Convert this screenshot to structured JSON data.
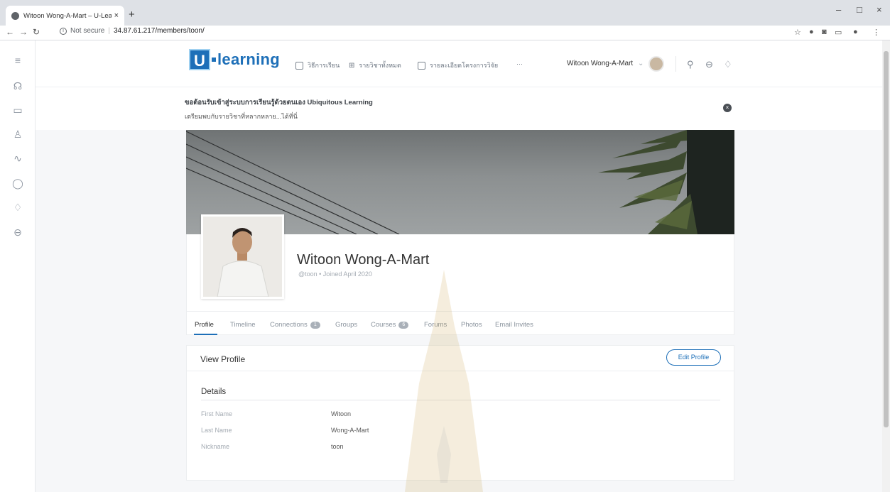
{
  "browser": {
    "tab_title": "Witoon Wong-A-Mart – U-Learn",
    "tab_close": "×",
    "new_tab": "+",
    "url_security": "Not secure",
    "url": "34.87.61.217/members/toon/",
    "window_controls": [
      "–",
      "□",
      "×"
    ]
  },
  "header": {
    "logo_text": "learning",
    "logo_letter": "U",
    "menu": [
      "วิธีการเรียน",
      "รายวิชาทั้งหมด",
      "รายละเอียดโครงการวิจัย",
      "···"
    ],
    "user_name": "Witoon Wong-A-Mart"
  },
  "welcome": {
    "title": "ขอต้อนรับเข้าสู่ระบบการเรียนรู้ด้วยตนเอง Ubiquitous Learning",
    "subtitle": "เตรียมพบกับรายวิชาที่หลากหลาย...ได้ที่นี่",
    "close": "×"
  },
  "profile": {
    "name": "Witoon Wong-A-Mart",
    "meta": "@toon • Joined April 2020",
    "tabs": [
      {
        "label": "Profile",
        "badge": ""
      },
      {
        "label": "Timeline",
        "badge": ""
      },
      {
        "label": "Connections",
        "badge": "1"
      },
      {
        "label": "Groups",
        "badge": ""
      },
      {
        "label": "Courses",
        "badge": "6"
      },
      {
        "label": "Forums",
        "badge": ""
      },
      {
        "label": "Photos",
        "badge": ""
      },
      {
        "label": "Email Invites",
        "badge": ""
      }
    ]
  },
  "panel": {
    "title": "View Profile",
    "edit_button": "Edit Profile",
    "details_title": "Details",
    "fields": [
      {
        "label": "First Name",
        "value": "Witoon"
      },
      {
        "label": "Last Name",
        "value": "Wong-A-Mart"
      },
      {
        "label": "Nickname",
        "value": "toon"
      }
    ]
  },
  "colors": {
    "accent": "#1d6fb8",
    "sidebar_icon": "#8e96a1"
  }
}
